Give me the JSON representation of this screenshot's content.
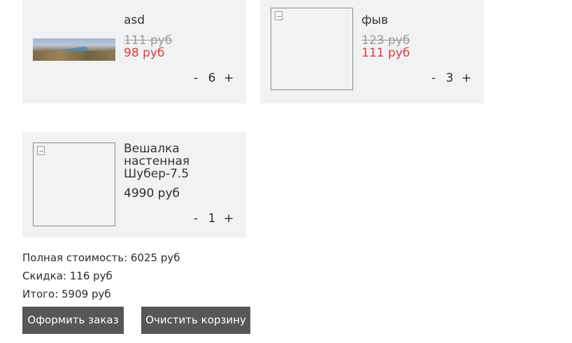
{
  "cart": {
    "items": [
      {
        "title": "asd",
        "old_price": "111 руб",
        "new_price": "98 руб",
        "quantity": "6",
        "image": "landscape-photo"
      },
      {
        "title": "фыв",
        "old_price": "123 руб",
        "new_price": "111 руб",
        "quantity": "3",
        "image": "broken-image-icon"
      },
      {
        "title": "Вешалка настенная Шубер-7.5",
        "price": "4990 руб",
        "quantity": "1",
        "image": "broken-image-icon"
      }
    ],
    "minus_label": "-",
    "plus_label": "+"
  },
  "summary": {
    "total": "Полная стоимость: 6025 руб",
    "discount": "Скидка: 116 руб",
    "final": "Итого: 5909 руб"
  },
  "actions": {
    "checkout_label": "Оформить заказ",
    "clear_label": "Очистить корзину"
  },
  "colors": {
    "card_bg": "#f1f2f4",
    "discount_price": "#e0383b",
    "button_bg": "#575757"
  }
}
